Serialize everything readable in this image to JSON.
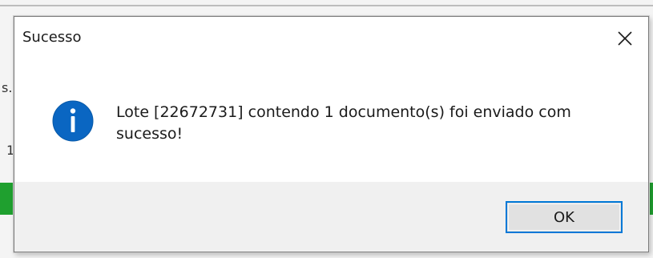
{
  "background": {
    "fragment_1": "s.",
    "fragment_2": "1"
  },
  "dialog": {
    "title": "Sucesso",
    "close_icon": "close-icon",
    "info_icon": "info-icon",
    "message": "Lote [22672731] contendo 1 documento(s) foi enviado com sucesso!",
    "ok_label": "OK"
  },
  "colors": {
    "info_blue": "#0078d7",
    "button_border": "#0078d7",
    "background_green": "#1fa02f"
  }
}
